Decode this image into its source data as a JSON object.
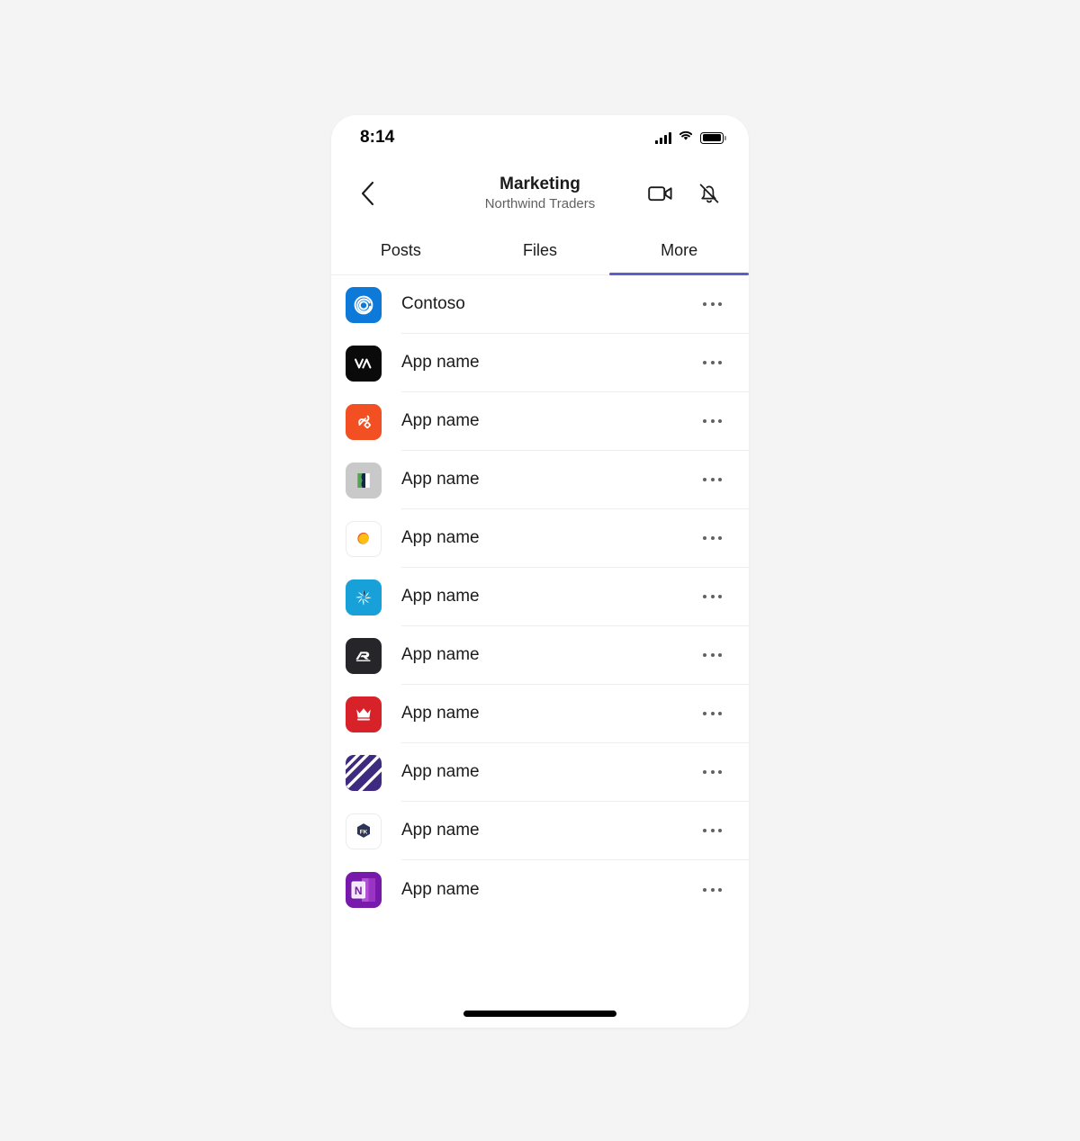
{
  "theme": {
    "accent": "#5b5fc7",
    "page_bg": "#f4f4f4",
    "phone_bg": "#ffffff",
    "text_primary": "#1b1b1b",
    "text_secondary": "#616161",
    "divider": "#ededed"
  },
  "status_bar": {
    "time": "8:14",
    "cellular_icon": "cellular-signal-icon",
    "wifi_icon": "wifi-icon",
    "battery_icon": "battery-full-icon"
  },
  "header": {
    "back_icon": "chevron-left-icon",
    "title": "Marketing",
    "subtitle": "Northwind Traders",
    "actions": [
      {
        "name": "video-call-icon",
        "label": "Video call"
      },
      {
        "name": "notifications-off-icon",
        "label": "Mute notifications"
      }
    ]
  },
  "tabs": {
    "items": [
      {
        "label": "Posts",
        "active": false
      },
      {
        "label": "Files",
        "active": false
      },
      {
        "label": "More",
        "active": true
      }
    ]
  },
  "app_list": {
    "more_button_label": "More options",
    "items": [
      {
        "name": "Contoso",
        "icon": "contoso-spiral-icon",
        "bg": "#0d7ad9"
      },
      {
        "name": "App name",
        "icon": "va-monogram-icon",
        "bg": "#0a0a0a"
      },
      {
        "name": "App name",
        "icon": "orange-knot-icon",
        "bg": "#f25022"
      },
      {
        "name": "App name",
        "icon": "green-navy-flag-icon",
        "bg": "#c8c8c8"
      },
      {
        "name": "App name",
        "icon": "yellow-blob-icon",
        "bg": "#ffffff"
      },
      {
        "name": "App name",
        "icon": "blue-starburst-icon",
        "bg": "#18a0d8"
      },
      {
        "name": "App name",
        "icon": "ar-monogram-icon",
        "bg": "#26262a"
      },
      {
        "name": "App name",
        "icon": "red-crown-icon",
        "bg": "#d7222a"
      },
      {
        "name": "App name",
        "icon": "purple-stripes-icon",
        "bg": "#3f2a82"
      },
      {
        "name": "App name",
        "icon": "fk-hexagon-icon",
        "bg": "#ffffff"
      },
      {
        "name": "App name",
        "icon": "onenote-icon",
        "bg": "#7719aa"
      }
    ]
  },
  "home_indicator": {
    "name": "home-indicator"
  }
}
